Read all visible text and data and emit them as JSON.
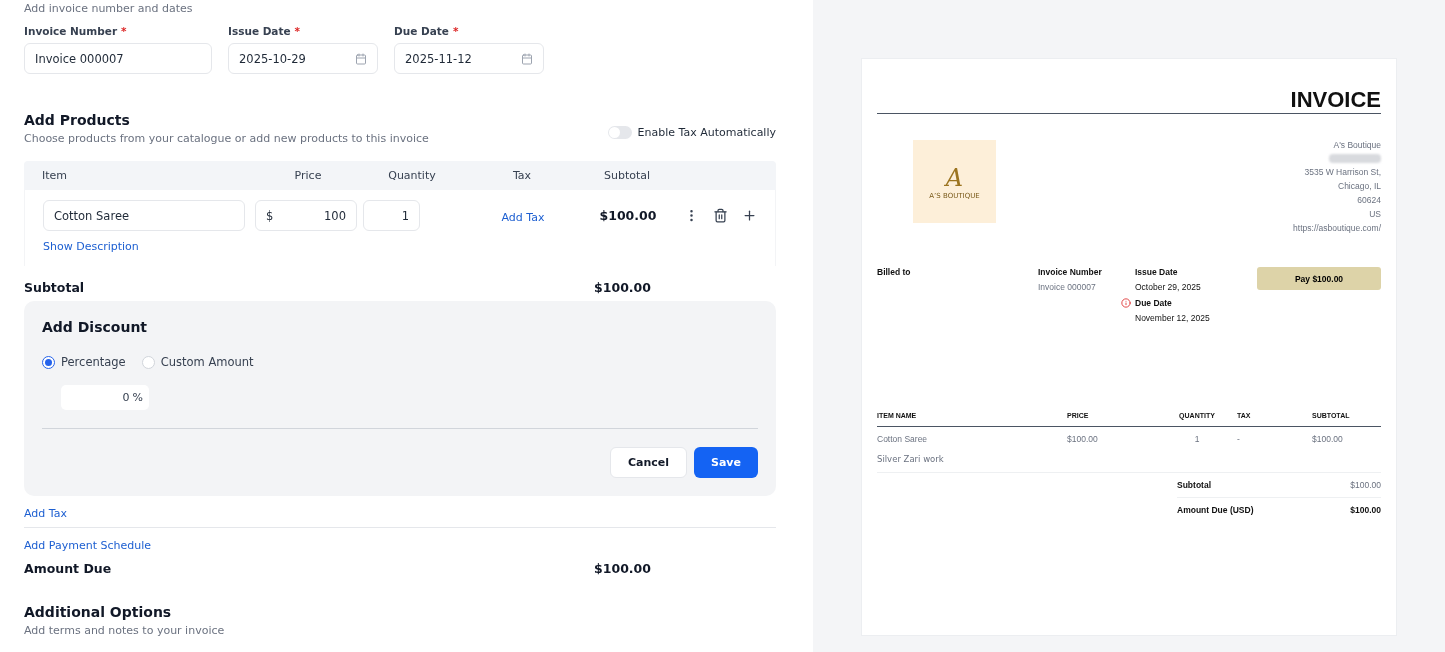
{
  "form": {
    "section_hint": "Add invoice number and dates",
    "fields": [
      {
        "label": "Invoice Number",
        "required_mark": "*",
        "value": "Invoice 000007",
        "kind": "text"
      },
      {
        "label": "Issue Date",
        "required_mark": "*",
        "value": "2025-10-29",
        "kind": "date"
      },
      {
        "label": "Due Date",
        "required_mark": "*",
        "value": "2025-11-12",
        "kind": "date"
      }
    ],
    "products": {
      "title": "Add Products",
      "subtitle": "Choose products from your catalogue or add new products to this invoice",
      "tax_toggle": {
        "label": "Enable Tax Automatically",
        "on": false
      },
      "columns": [
        "Item",
        "Price",
        "Quantity",
        "Tax",
        "Subtotal"
      ],
      "rows": [
        {
          "item": "Cotton Saree",
          "currency": "$",
          "price": "100",
          "quantity": "1",
          "tax_link": "Add Tax",
          "subtotal": "$100.00",
          "description_link": "Show Description"
        }
      ]
    },
    "subtotal": {
      "label": "Subtotal",
      "value": "$100.00"
    },
    "discount": {
      "title": "Add Discount",
      "options": [
        {
          "label": "Percentage",
          "selected": true
        },
        {
          "label": "Custom Amount",
          "selected": false
        }
      ],
      "value": "0",
      "unit": "%",
      "buttons": [
        {
          "label": "Cancel",
          "kind": "secondary"
        },
        {
          "label": "Save",
          "kind": "primary"
        }
      ]
    },
    "links": [
      "Add Tax",
      "Add Payment Schedule"
    ],
    "amount_due": {
      "label": "Amount Due",
      "value": "$100.00"
    },
    "additional": {
      "title": "Additional Options",
      "subtitle": "Add terms and notes to your invoice"
    }
  },
  "preview": {
    "title": "INVOICE",
    "logo": {
      "letter": "A",
      "name": "A’S BOUTIQUE"
    },
    "company": [
      "A's Boutique",
      "3535 W Harrison St,",
      "Chicago, IL",
      "60624",
      "US",
      "https://asboutique.com/"
    ],
    "billed_to": "Billed to",
    "invoice_number": {
      "label": "Invoice Number",
      "value": "Invoice 000007"
    },
    "issue_date": {
      "label": "Issue Date",
      "value": "October 29, 2025"
    },
    "due_date": {
      "label": "Due Date",
      "value": "November 12, 2025"
    },
    "pay_button": "Pay $100.00",
    "columns": [
      "ITEM NAME",
      "PRICE",
      "QUANTITY",
      "TAX",
      "SUBTOTAL"
    ],
    "rows": [
      {
        "name": "Cotton Saree",
        "description": "Silver Zari work",
        "price": "$100.00",
        "quantity": "1",
        "tax": "-",
        "subtotal": "$100.00"
      }
    ],
    "totals": [
      {
        "label": "Subtotal",
        "value": "$100.00",
        "kind": "plain"
      },
      {
        "label": "Amount Due (USD)",
        "value": "$100.00",
        "kind": "strong"
      }
    ]
  }
}
